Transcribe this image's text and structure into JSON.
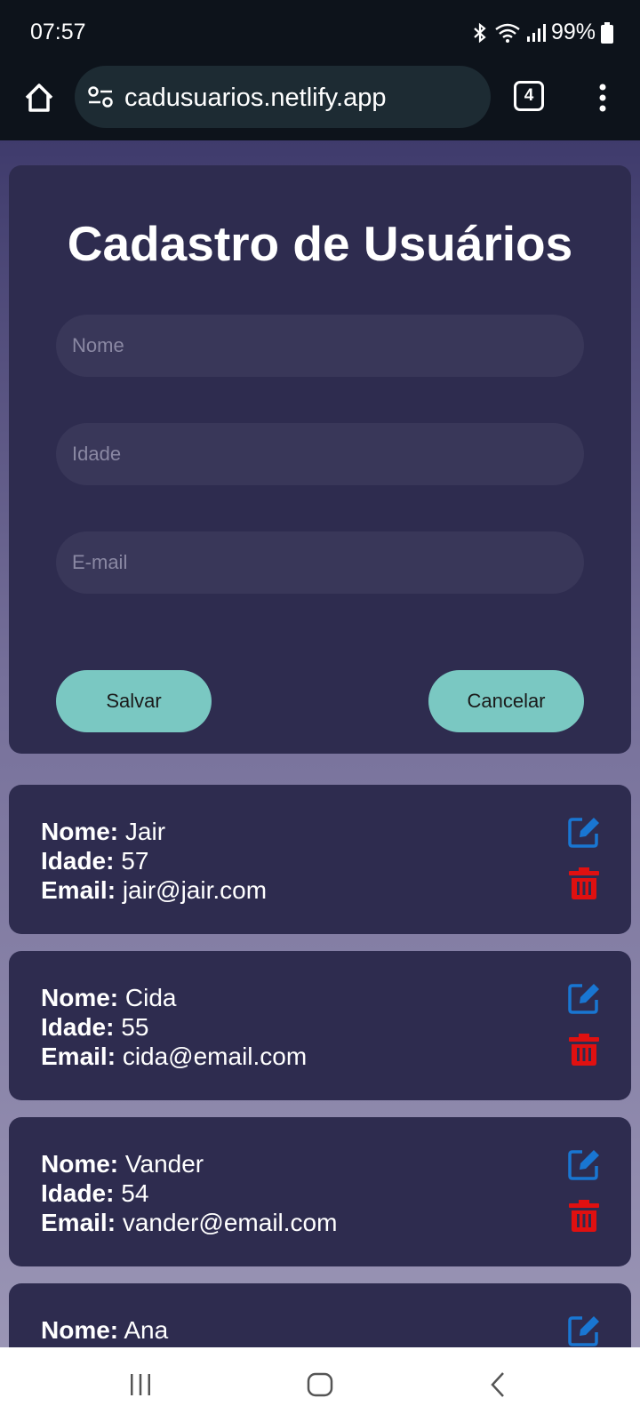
{
  "status": {
    "time": "07:57",
    "battery": "99%"
  },
  "browser": {
    "url": "cadusuarios.netlify.app",
    "tab_count": "4"
  },
  "form": {
    "title": "Cadastro de Usuários",
    "name_placeholder": "Nome",
    "age_placeholder": "Idade",
    "email_placeholder": "E-mail",
    "save_label": "Salvar",
    "cancel_label": "Cancelar"
  },
  "labels": {
    "name": "Nome:",
    "age": "Idade:",
    "email": "Email:"
  },
  "users": [
    {
      "name": "Jair",
      "age": "57",
      "email": "jair@jair.com"
    },
    {
      "name": "Cida",
      "age": "55",
      "email": "cida@email.com"
    },
    {
      "name": "Vander",
      "age": "54",
      "email": "vander@email.com"
    },
    {
      "name": "Ana"
    }
  ],
  "colors": {
    "edit": "#1976d2",
    "delete": "#e01010",
    "button": "#7ac8c2",
    "card": "#2e2c4f"
  },
  "icons": {
    "edit": "edit-icon",
    "delete": "trash-icon"
  }
}
